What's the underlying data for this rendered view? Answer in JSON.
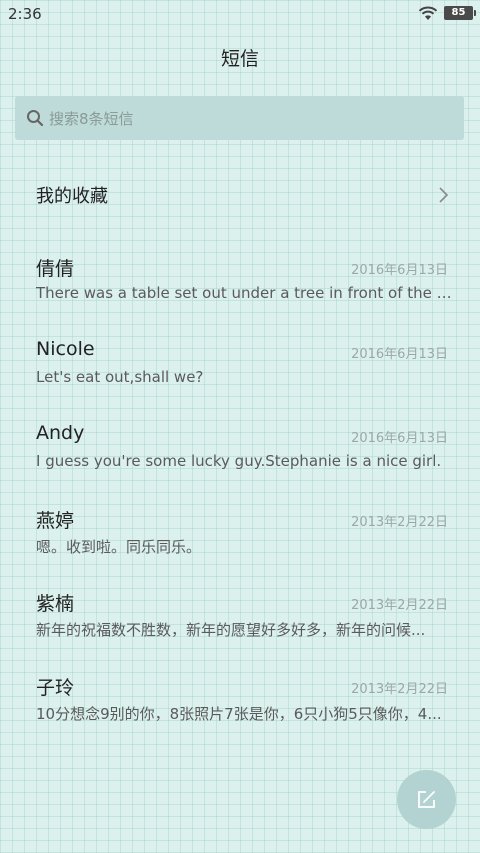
{
  "status_bar": {
    "time": "2:36",
    "battery": "85",
    "wifi_icon": "wifi-icon"
  },
  "header": {
    "title": "短信"
  },
  "search": {
    "placeholder": "搜索8条短信",
    "icon": "search-icon"
  },
  "favorites": {
    "label": "我的收藏",
    "icon": "chevron-right-icon"
  },
  "messages": [
    {
      "name": "倩倩",
      "date": "2016年6月13日",
      "preview": "There was a table set out under a tree in front of the ho..."
    },
    {
      "name": "Nicole",
      "date": "2016年6月13日",
      "preview": "Let's eat out,shall we?"
    },
    {
      "name": "Andy",
      "date": "2016年6月13日",
      "preview": "I guess you're some lucky guy.Stephanie is a nice girl."
    },
    {
      "name": "燕婷",
      "date": "2013年2月22日",
      "preview": "嗯。收到啦。同乐同乐。"
    },
    {
      "name": "紫楠",
      "date": "2013年2月22日",
      "preview": "新年的祝福数不胜数，新年的愿望好多好多，新年的问候..."
    },
    {
      "name": "子玲",
      "date": "2013年2月22日",
      "preview": "10分想念9别的你，8张照片7张是你，6只小狗5只像你，4..."
    }
  ],
  "compose": {
    "icon": "compose-icon"
  },
  "colors": {
    "background": "#dcf1ee",
    "search_bg": "#bedbd9",
    "compose_bg": "#b2d3d1",
    "date_text": "#9aa8a6"
  }
}
